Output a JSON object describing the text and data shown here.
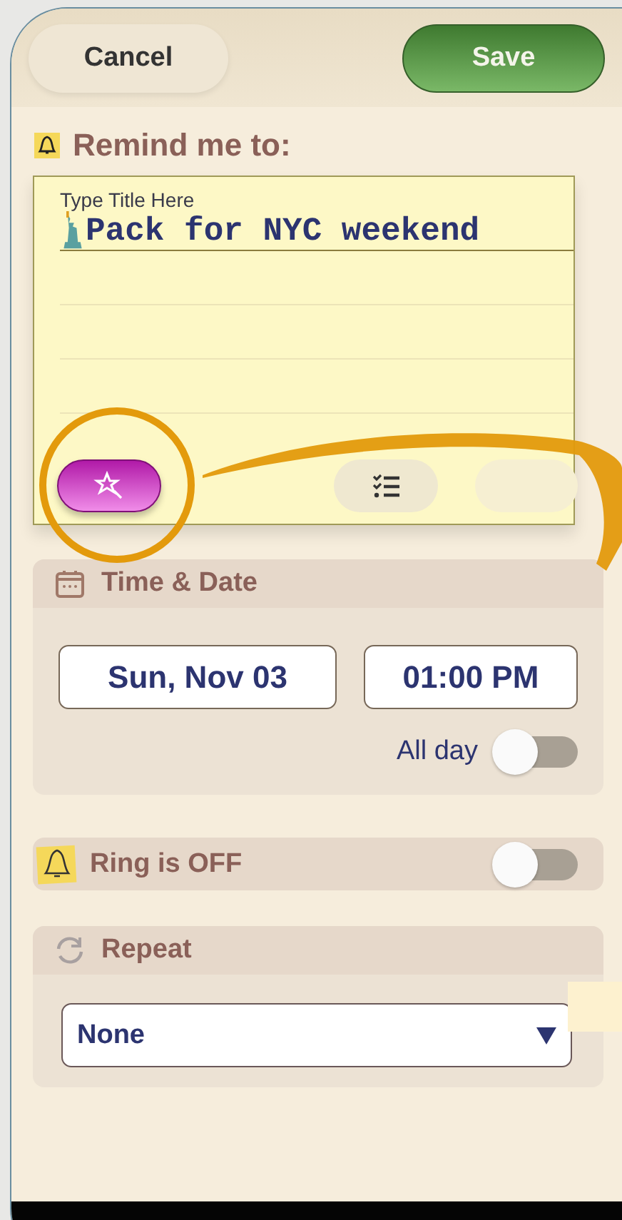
{
  "header": {
    "cancel": "Cancel",
    "save": "Save"
  },
  "remind": {
    "heading": "Remind me to:",
    "title_label": "Type Title Here",
    "title_value": "Pack for NYC weekend"
  },
  "toolbar": [
    {
      "kind": "magic",
      "selected": true
    },
    {
      "kind": "checklist",
      "selected": false
    },
    {
      "kind": "blank",
      "selected": false
    }
  ],
  "time_date": {
    "heading": "Time & Date",
    "date": "Sun, Nov 03",
    "time": "01:00 PM",
    "all_day_label": "All day",
    "all_day": false
  },
  "ring": {
    "label": "Ring is OFF",
    "on": false
  },
  "repeat": {
    "heading": "Repeat",
    "value": "None"
  }
}
